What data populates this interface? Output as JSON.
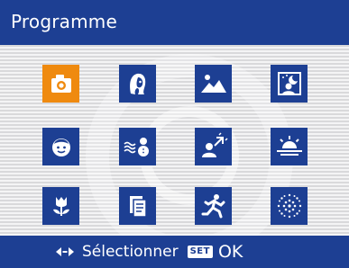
{
  "header": {
    "title": "Programme"
  },
  "modes": [
    {
      "icon": "camera-icon",
      "selected": true
    },
    {
      "icon": "portrait-icon",
      "selected": false
    },
    {
      "icon": "landscape-icon",
      "selected": false
    },
    {
      "icon": "night-portrait-icon",
      "selected": false
    },
    {
      "icon": "child-face-icon",
      "selected": false
    },
    {
      "icon": "snow-icon",
      "selected": false
    },
    {
      "icon": "backlight-portrait-icon",
      "selected": false
    },
    {
      "icon": "sunset-icon",
      "selected": false
    },
    {
      "icon": "flower-macro-icon",
      "selected": false
    },
    {
      "icon": "document-icon",
      "selected": false
    },
    {
      "icon": "sports-icon",
      "selected": false
    },
    {
      "icon": "fireworks-icon",
      "selected": false
    }
  ],
  "footer": {
    "nav_icon": "left-right-arrows-icon",
    "select_label": "Sélectionner",
    "set_label": "SET",
    "ok_label": "OK"
  },
  "colors": {
    "accent": "#1d3f93",
    "selected": "#ef8a0f",
    "text": "#ffffff"
  }
}
